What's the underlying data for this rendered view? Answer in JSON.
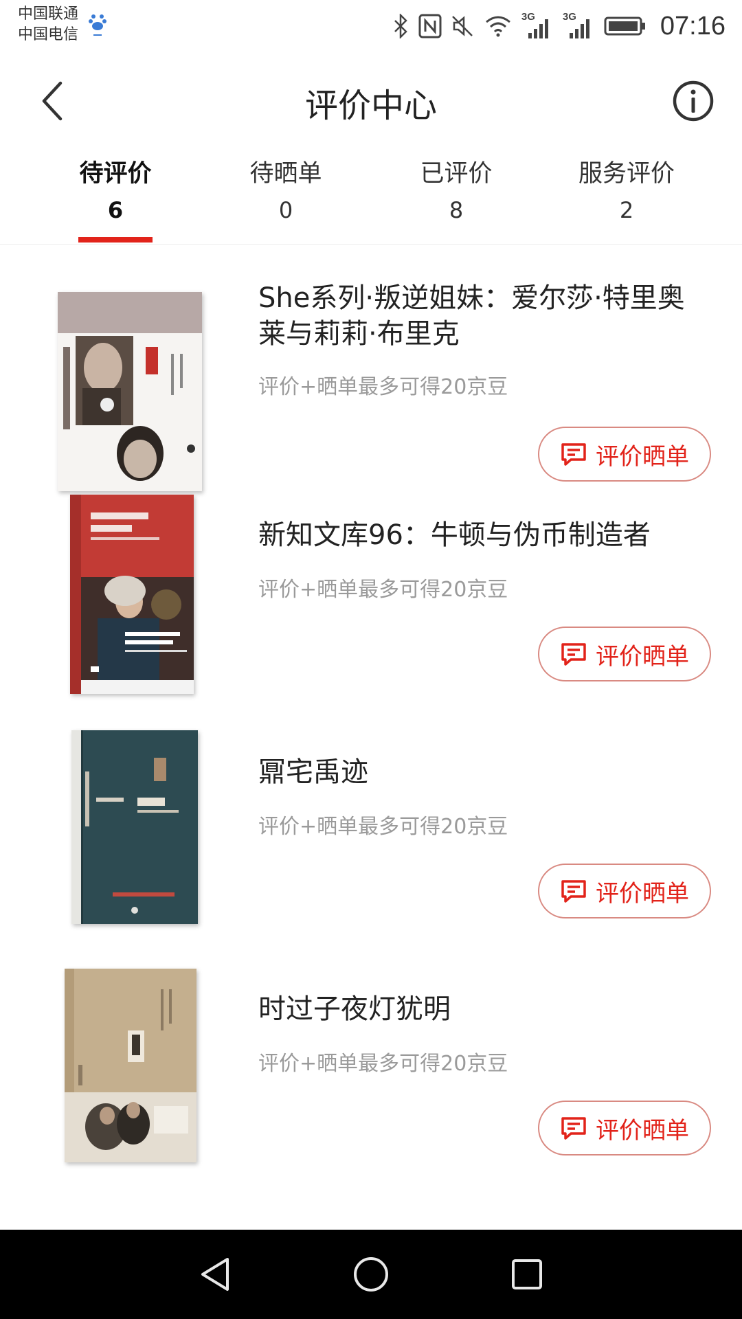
{
  "status_bar": {
    "carrier_1": "中国联通",
    "carrier_2": "中国电信",
    "time": "07:16",
    "network_1": "3G",
    "network_2": "3G"
  },
  "header": {
    "title": "评价中心"
  },
  "tabs": [
    {
      "label": "待评价",
      "count": "6",
      "active": true
    },
    {
      "label": "待晒单",
      "count": "0",
      "active": false
    },
    {
      "label": "已评价",
      "count": "8",
      "active": false
    },
    {
      "label": "服务评价",
      "count": "2",
      "active": false
    }
  ],
  "items": [
    {
      "title": "She系列·叛逆姐妹：爱尔莎·特里奥莱与莉莉·布里克",
      "hint": "评价+晒单最多可得20京豆",
      "button": "评价晒单"
    },
    {
      "title": "新知文库96：牛顿与伪币制造者",
      "hint": "评价+晒单最多可得20京豆",
      "button": "评价晒单"
    },
    {
      "title": "鼏宅禹迹",
      "hint": "评价+晒单最多可得20京豆",
      "button": "评价晒单"
    },
    {
      "title": "时过子夜灯犹明",
      "hint": "评价+晒单最多可得20京豆",
      "button": "评价晒单"
    }
  ],
  "colors": {
    "accent": "#e2231a",
    "hint_text": "#9a9a9a"
  }
}
